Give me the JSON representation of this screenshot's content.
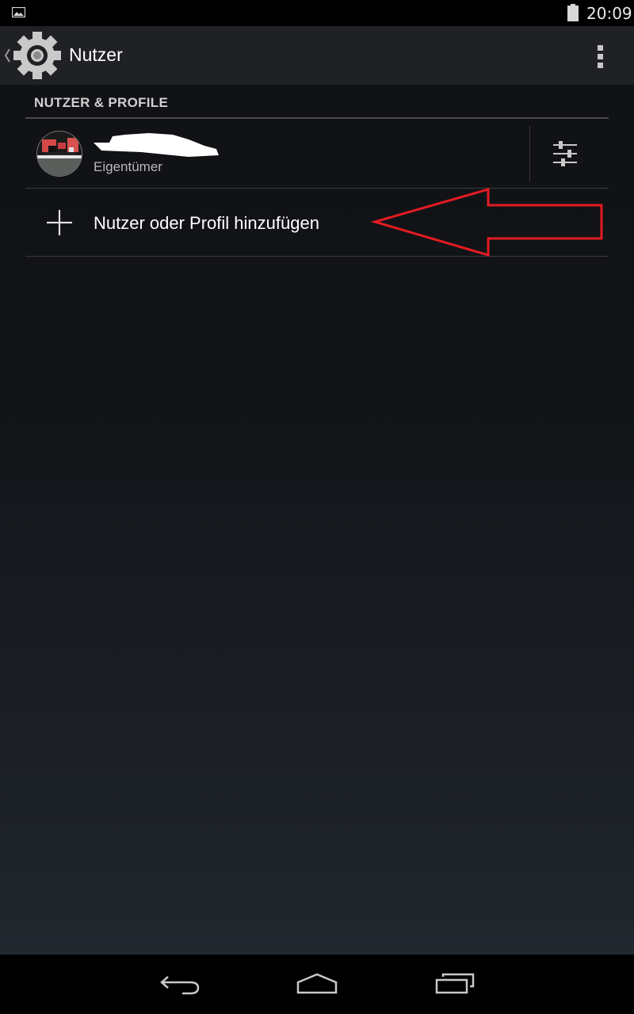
{
  "status_bar": {
    "time": "20:09",
    "icons": [
      "image-notification-icon",
      "battery-icon"
    ]
  },
  "action_bar": {
    "title": "Nutzer",
    "icons": [
      "back-chevron-icon",
      "settings-gear-icon",
      "overflow-menu-icon"
    ]
  },
  "section": {
    "header": "NUTZER & PROFILE"
  },
  "users": [
    {
      "name": "",
      "name_redacted": true,
      "role": "Eigentümer",
      "settings_icon": "sliders-icon"
    }
  ],
  "add_user": {
    "label": "Nutzer oder Profil hinzufügen",
    "icon": "plus-icon"
  },
  "annotation": {
    "type": "red-arrow-outline",
    "color": "#e31b23",
    "points_to": "add_user"
  },
  "nav_bar": {
    "buttons": [
      "back-icon",
      "home-icon",
      "recents-icon"
    ]
  },
  "colors": {
    "status_bar": "#000000",
    "action_bar": "#202124",
    "text_primary": "#ffffff",
    "text_secondary": "#b8b8b8",
    "annotation_red": "#e31b23"
  }
}
